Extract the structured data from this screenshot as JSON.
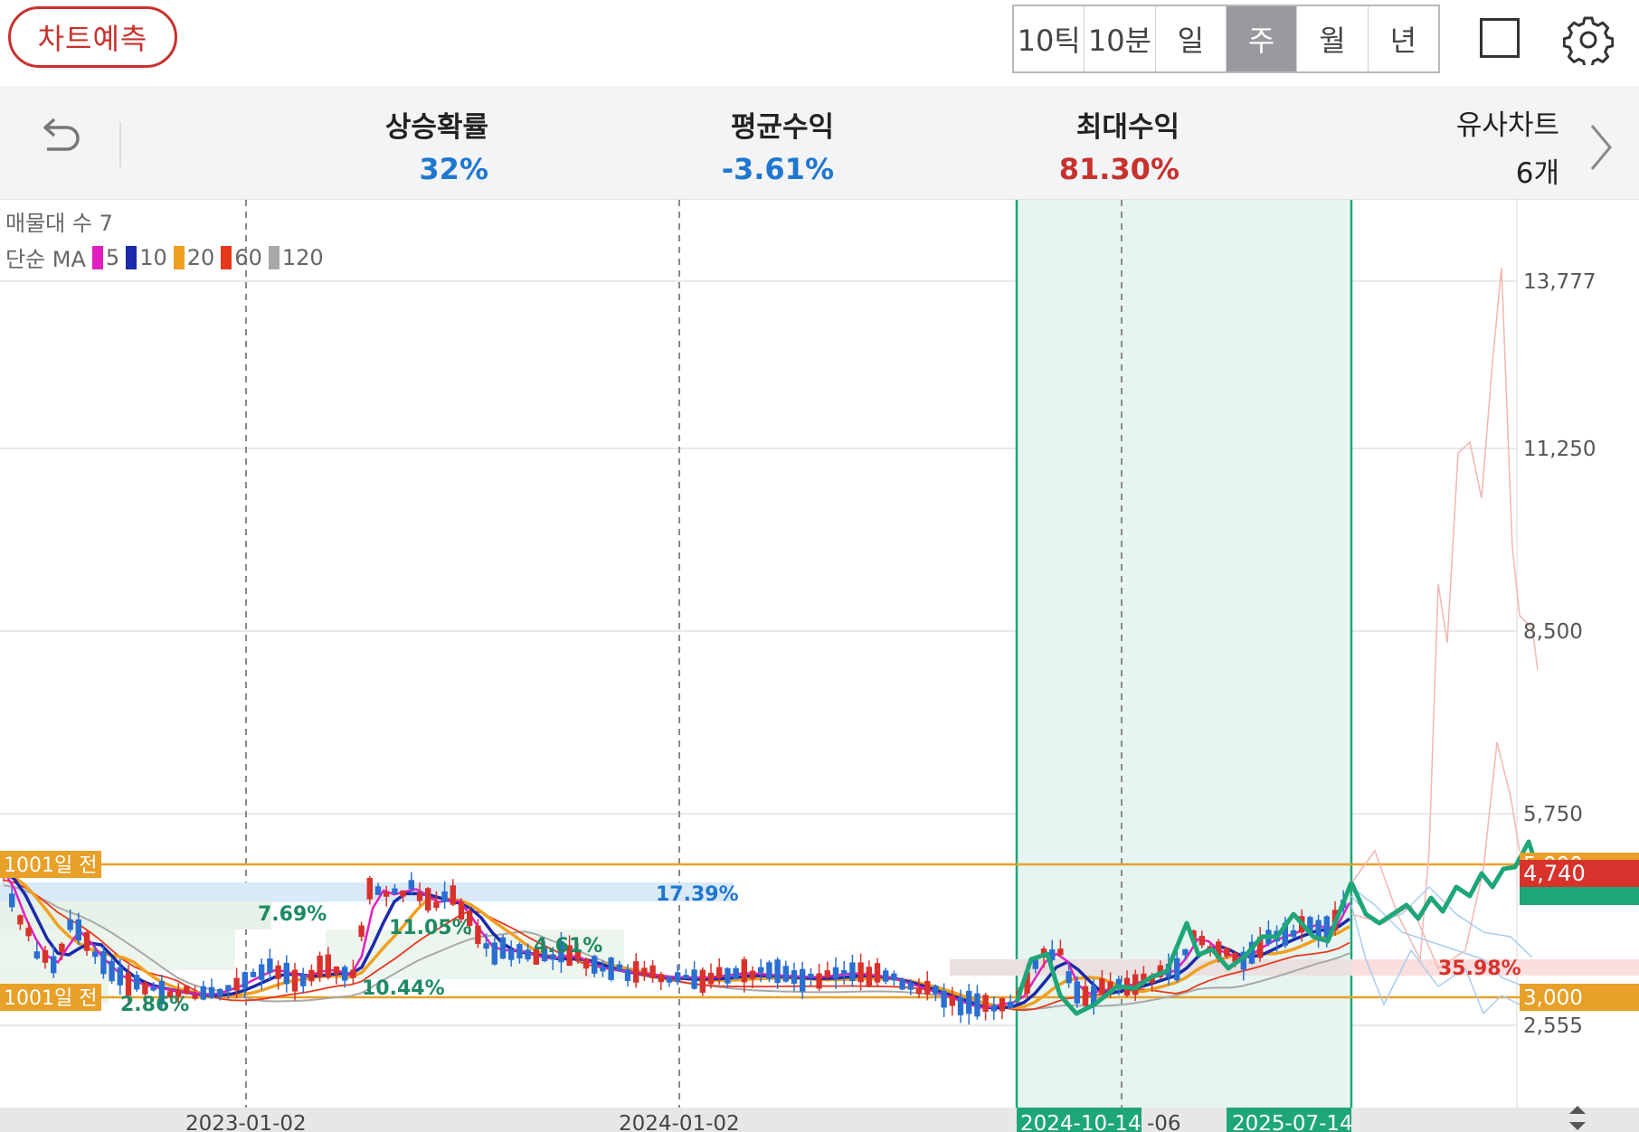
{
  "toolbar": {
    "predict_label": "차트예측",
    "periods": [
      "10틱",
      "10분",
      "일",
      "주",
      "월",
      "년"
    ],
    "active_period": "주"
  },
  "summary": {
    "rise_prob_label": "상승확률",
    "rise_prob_value": "32%",
    "avg_return_label": "평균수익",
    "avg_return_value": "-3.61%",
    "max_return_label": "최대수익",
    "max_return_value": "81.30%",
    "similar_label": "유사차트",
    "similar_count": "6개"
  },
  "chart": {
    "volume_profile_label": "매물대 수 7",
    "ma_prefix": "단순 MA",
    "ma_legend": [
      {
        "period": "5",
        "color": "#e020c0"
      },
      {
        "period": "10",
        "color": "#1a2aa8"
      },
      {
        "period": "20",
        "color": "#f0a020"
      },
      {
        "period": "60",
        "color": "#e8381c"
      },
      {
        "period": "120",
        "color": "#a8a8a8"
      }
    ],
    "y_ticks": [
      "13,777",
      "11,250",
      "8,500",
      "5,750",
      "2,555"
    ],
    "price_tags": {
      "upper_line": "5,000",
      "current": "4,740",
      "lower_line": "3,000",
      "upper_ref": "1001일 전",
      "lower_ref": "1001일 전"
    },
    "x_labels": [
      "2023-01-02",
      "2024-01-02"
    ],
    "selection_start": "2024-10-14",
    "selection_mid": "-06",
    "selection_end": "2025-07-14",
    "range_labels": [
      "7.69%",
      "17.39%",
      "11.05%",
      "4.61%",
      "10.44%",
      "2.86%",
      "35.98%"
    ],
    "colors": {
      "up": "#d8322c",
      "down": "#2a6fd0",
      "prediction": "#1ea679",
      "selection": "#1ea679",
      "level": "#e8a028"
    }
  }
}
